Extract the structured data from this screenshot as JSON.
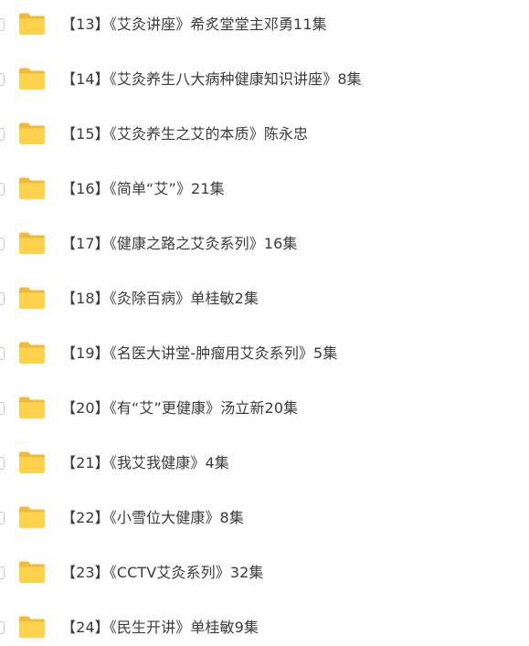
{
  "folders": [
    {
      "name": "【13】《艾灸讲座》希炙堂堂主邓勇11集",
      "icon": "folder-icon"
    },
    {
      "name": "【14】《艾灸养生八大病种健康知识讲座》8集",
      "icon": "folder-icon"
    },
    {
      "name": "【15】《艾灸养生之艾的本质》陈永忠",
      "icon": "folder-icon"
    },
    {
      "name": "【16】《简单“艾”》21集",
      "icon": "folder-icon"
    },
    {
      "name": "【17】《健康之路之艾灸系列》16集",
      "icon": "folder-icon"
    },
    {
      "name": "【18】《灸除百病》单桂敏2集",
      "icon": "folder-icon"
    },
    {
      "name": "【19】《名医大讲堂-肿瘤用艾灸系列》5集",
      "icon": "folder-icon"
    },
    {
      "name": "【20】《有“艾”更健康》汤立新20集",
      "icon": "folder-icon"
    },
    {
      "name": "【21】《我艾我健康》4集",
      "icon": "folder-icon"
    },
    {
      "name": "【22】《小雪位大健康》8集",
      "icon": "folder-icon"
    },
    {
      "name": "【23】《CCTV艾灸系列》32集",
      "icon": "folder-icon"
    },
    {
      "name": "【24】《民生开讲》单桂敏9集",
      "icon": "folder-icon"
    }
  ],
  "colors": {
    "folder_body": "#FFD24D",
    "folder_back": "#F5B93A",
    "text": "#3b3b3b"
  }
}
